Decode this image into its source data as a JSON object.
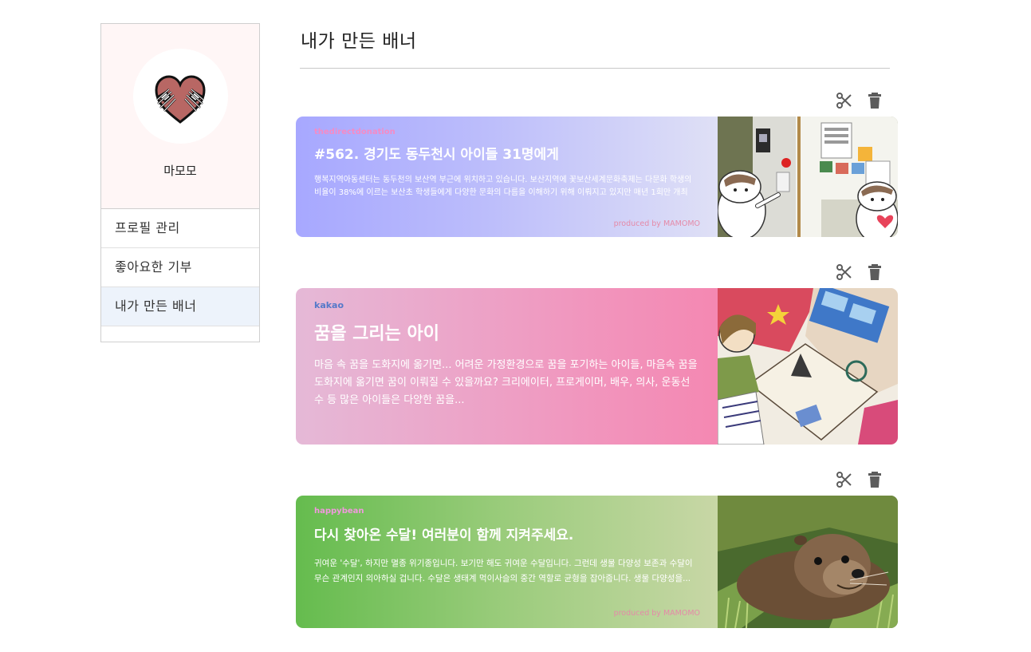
{
  "sidebar": {
    "username": "마모모",
    "avatar_icon": "heart-hands-icon",
    "items": [
      {
        "label": "프로필 관리"
      },
      {
        "label": "좋아요한 기부"
      },
      {
        "label": "내가 만든 배너"
      }
    ],
    "active_index": 2
  },
  "page": {
    "title": "내가 만든 배너"
  },
  "banners": [
    {
      "source": "thedirectdonation",
      "title": "#562. 경기도 동두천시 아이들 31명에게",
      "description": "행복지역아동센터는 동두천의 보산역 부근에 위치하고 있습니다. 보산지역에 꽃보산세계문화축제는 다문화 학생의 비율이 38%에 이르는 보산초 학생들에게 다양한 문화의 다름을 이해하기 위해 이뤄지고 있지만 매년 1회만 개최",
      "produced_by": "produced by MAMOMO",
      "image": "daycare-center-door-with-cartoon-characters",
      "edit_icon": "scissors-icon",
      "delete_icon": "trash-icon"
    },
    {
      "source": "kakao",
      "title": "꿈을 그리는 아이",
      "description": "마음 속 꿈을 도화지에 옮기면... 어려운 가정환경으로 꿈을 포기하는 아이들, 마음속 꿈을 도화지에 옮기면 꿈이 이뤄질 수 있을까요? 크리에이터, 프로게이머, 배우, 의사, 운동선수 등 많은 아이들은 다양한 꿈을...",
      "image": "child-watercolor-drawing",
      "edit_icon": "scissors-icon",
      "delete_icon": "trash-icon"
    },
    {
      "source": "happybean",
      "title": "다시 찾아온 수달! 여러분이 함께 지켜주세요.",
      "description": "귀여운 '수달', 하지만 멸종 위기종입니다. 보기만 해도 귀여운 수달입니다. 그런데 생물 다양성 보존과 수달이 무슨 관계인지 의아하실 겁니다. 수달은 생태계 먹이사슬의 중간 역할로 균형을 잡아줍니다. 생물 다양성을...",
      "produced_by": "produced by MAMOMO",
      "image": "otter-in-grass-photo",
      "edit_icon": "scissors-icon",
      "delete_icon": "trash-icon"
    }
  ],
  "colors": {
    "sidebar_profile_bg": "#fff6f6",
    "active_menu_bg": "#edf3fb",
    "heart": "#b86764",
    "icon_gray": "#5c5c5c"
  }
}
